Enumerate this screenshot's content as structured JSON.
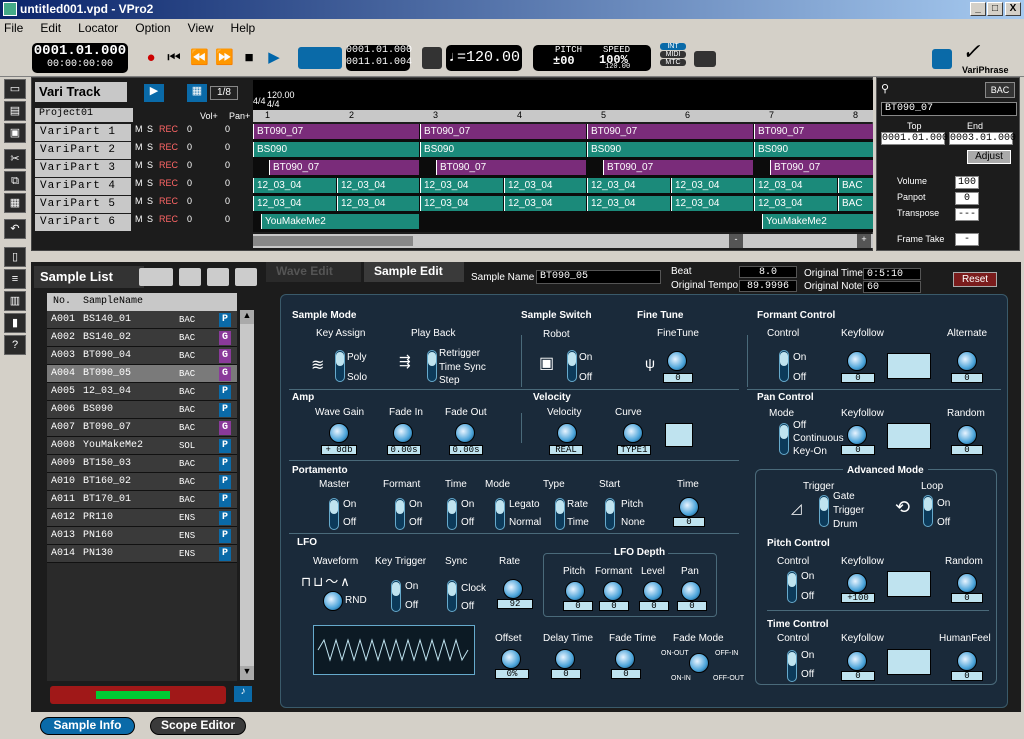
{
  "window": {
    "title": "untitled001.vpd - VPro2",
    "min": "_",
    "max": "□",
    "close": "X"
  },
  "menu": [
    "File",
    "Edit",
    "Locator",
    "Option",
    "View",
    "Help"
  ],
  "toolbar": {
    "pos_bars": "0001.01.000",
    "pos_time": "00:00:00:00",
    "loop_start": "0001.01.000",
    "loop_end": "0011.01.004",
    "tempo": "♩=120.00",
    "pitch_label": "PITCH",
    "pitch_val": "±00",
    "speed_label": "SPEED",
    "speed_val": "100%",
    "speed_sub": "120.00",
    "sync": [
      "INT",
      "MIDI",
      "MTC"
    ],
    "brand": "VariPhrase"
  },
  "vari": {
    "title": "Vari Track",
    "quant": "1/8",
    "project": "Project01",
    "vol_hdr": "Vol+",
    "pan_hdr": "Pan+",
    "tempo_mark": "120.00",
    "sig_mark": "4/4",
    "sig_mark2": "4/4",
    "bars": [
      "1",
      "2",
      "3",
      "4",
      "5",
      "6",
      "7",
      "8"
    ],
    "rows": [
      {
        "name": "VariPart 1"
      },
      {
        "name": "VariPart 2"
      },
      {
        "name": "VariPart 3"
      },
      {
        "name": "VariPart 4"
      },
      {
        "name": "VariPart 5"
      },
      {
        "name": "VariPart 6"
      }
    ],
    "ms": "M",
    "ss": "S",
    "rec": "REC",
    "zero": "0"
  },
  "clips": {
    "bac": "BAC",
    "sol": "SOL",
    "bt090": "BT090_07",
    "bs090": "BS090",
    "c12": "12_03_04",
    "you": "YouMakeMe2"
  },
  "right": {
    "name": "BT090_07",
    "bac": "BAC",
    "top_label": "Top",
    "top_val": "0001.01.000",
    "end_label": "End",
    "end_val": "0003.01.000",
    "adjust": "Adjust",
    "volume_label": "Volume",
    "volume_val": "100",
    "panpot_label": "Panpot",
    "panpot_val": "0",
    "transpose_label": "Transpose",
    "transpose_val": "---",
    "frame_label": "Frame Take",
    "frame_val": "-"
  },
  "samplelist": {
    "title": "Sample List",
    "col_no": "No.",
    "col_name": "SampleName",
    "rows": [
      {
        "no": "A001",
        "name": "BS140_01",
        "type": "BAC",
        "tag": "P"
      },
      {
        "no": "A002",
        "name": "BS140_02",
        "type": "BAC",
        "tag": "G"
      },
      {
        "no": "A003",
        "name": "BT090_04",
        "type": "BAC",
        "tag": "G"
      },
      {
        "no": "A004",
        "name": "BT090_05",
        "type": "BAC",
        "tag": "G"
      },
      {
        "no": "A005",
        "name": "12_03_04",
        "type": "BAC",
        "tag": "P"
      },
      {
        "no": "A006",
        "name": "BS090",
        "type": "BAC",
        "tag": "P"
      },
      {
        "no": "A007",
        "name": "BT090_07",
        "type": "BAC",
        "tag": "G"
      },
      {
        "no": "A008",
        "name": "YouMakeMe2",
        "type": "SOL",
        "tag": "P"
      },
      {
        "no": "A009",
        "name": "BT150_03",
        "type": "BAC",
        "tag": "P"
      },
      {
        "no": "A010",
        "name": "BT160_02",
        "type": "BAC",
        "tag": "P"
      },
      {
        "no": "A011",
        "name": "BT170_01",
        "type": "BAC",
        "tag": "P"
      },
      {
        "no": "A012",
        "name": "PR110",
        "type": "ENS",
        "tag": "P"
      },
      {
        "no": "A013",
        "name": "PN160",
        "type": "ENS",
        "tag": "P"
      },
      {
        "no": "A014",
        "name": "PN130",
        "type": "ENS",
        "tag": "P"
      }
    ]
  },
  "edit": {
    "tab_wave": "Wave Edit",
    "tab_sample": "Sample Edit",
    "sample_name_label": "Sample Name",
    "sample_name": "BT090_05",
    "beat_label": "Beat",
    "beat_val": "8.0",
    "orig_tempo_label": "Original Tempo",
    "orig_tempo_val": "89.9996",
    "orig_time_label": "Original Time",
    "orig_time_val": "0:5:10",
    "orig_note_label": "Original Note",
    "orig_note_val": "60",
    "reset": "Reset"
  },
  "sm": {
    "title": "Sample Mode",
    "key_assign": "Key Assign",
    "poly": "Poly",
    "solo": "Solo",
    "playback": "Play Back",
    "retrigger": "Retrigger",
    "timesync": "Time Sync",
    "step": "Step"
  },
  "ss": {
    "title": "Sample Switch",
    "robot": "Robot",
    "on": "On",
    "off": "Off"
  },
  "ft": {
    "title": "Fine Tune",
    "finetune": "FineTune",
    "val": "0"
  },
  "fc": {
    "title": "Formant Control",
    "control": "Control",
    "on": "On",
    "off": "Off",
    "keyfollow": "Keyfollow",
    "kf_val": "0",
    "alternate": "Alternate",
    "alt_val": "0"
  },
  "amp": {
    "title": "Amp",
    "wave_gain": "Wave Gain",
    "wg_val": "+ 0db",
    "fade_in": "Fade In",
    "fi_val": "0.00s",
    "fade_out": "Fade Out",
    "fo_val": "0.00s"
  },
  "vel": {
    "title": "Velocity",
    "velocity": "Velocity",
    "vel_val": "REAL",
    "curve": "Curve",
    "curve_val": "TYPE1"
  },
  "pc": {
    "title": "Pan Control",
    "mode": "Mode",
    "off": "Off",
    "continuous": "Continuous",
    "keyon": "Key-On",
    "keyfollow": "Keyfollow",
    "kf_val": "0",
    "random": "Random",
    "rnd_val": "0"
  },
  "porta": {
    "title": "Portamento",
    "master": "Master",
    "formant": "Formant",
    "time": "Time",
    "mode": "Mode",
    "type": "Type",
    "start": "Start",
    "time2": "Time",
    "on": "On",
    "off": "Off",
    "legato": "Legato",
    "normal": "Normal",
    "rate": "Rate",
    "time_opt": "Time",
    "pitch": "Pitch",
    "none": "None",
    "tval": "0"
  },
  "adv": {
    "title": "Advanced Mode",
    "trigger": "Trigger",
    "gate": "Gate",
    "trigger_opt": "Trigger",
    "drum": "Drum",
    "loop": "Loop",
    "on": "On",
    "off": "Off"
  },
  "lfo": {
    "title": "LFO",
    "waveform": "Waveform",
    "rnd": "RND",
    "key_trigger": "Key Trigger",
    "on": "On",
    "off": "Off",
    "sync": "Sync",
    "clock": "Clock",
    "rate": "Rate",
    "rate_val": "92",
    "depth_title": "LFO Depth",
    "pitch": "Pitch",
    "formant": "Formant",
    "level": "Level",
    "pan": "Pan",
    "zero": "0",
    "offset": "Offset",
    "offset_val": "0%",
    "delay_time": "Delay Time",
    "fade_time": "Fade Time",
    "fade_mode": "Fade Mode",
    "onout": "ON-OUT",
    "offin": "OFF-IN",
    "onin": "ON-IN",
    "offout": "OFF-OUT"
  },
  "pitchc": {
    "title": "Pitch Control",
    "control": "Control",
    "on": "On",
    "off": "Off",
    "keyfollow": "Keyfollow",
    "kf_val": "+100",
    "random": "Random",
    "rnd_val": "0"
  },
  "timec": {
    "title": "Time Control",
    "control": "Control",
    "on": "On",
    "off": "Off",
    "keyfollow": "Keyfollow",
    "kf_val": "0",
    "humanfeel": "HumanFeel",
    "hf_val": "0"
  },
  "status": {
    "sample_info": "Sample Info",
    "scope_editor": "Scope Editor"
  }
}
